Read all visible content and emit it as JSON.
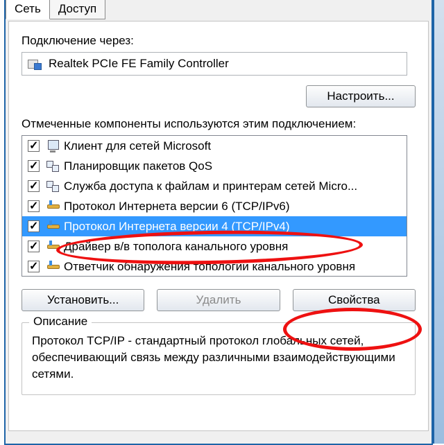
{
  "tabs": {
    "network": "Сеть",
    "access": "Доступ"
  },
  "connect_label": "Подключение через:",
  "adapter": "Realtek PCIe FE Family Controller",
  "configure_btn": "Настроить...",
  "components_label": "Отмеченные компоненты используются этим подключением:",
  "items": [
    "Клиент для сетей Microsoft",
    "Планировщик пакетов QoS",
    "Служба доступа к файлам и принтерам сетей Micro...",
    "Протокол Интернета версии 6 (TCP/IPv6)",
    "Протокол Интернета версии 4 (TCP/IPv4)",
    "Драйвер в/в тополога канального уровня",
    "Ответчик обнаружения топологии канального уровня"
  ],
  "install_btn": "Установить...",
  "remove_btn": "Удалить",
  "props_btn": "Свойства",
  "desc_title": "Описание",
  "desc_text": "Протокол TCP/IP - стандартный протокол глобальных сетей, обеспечивающий связь между различными взаимодействующими сетями."
}
